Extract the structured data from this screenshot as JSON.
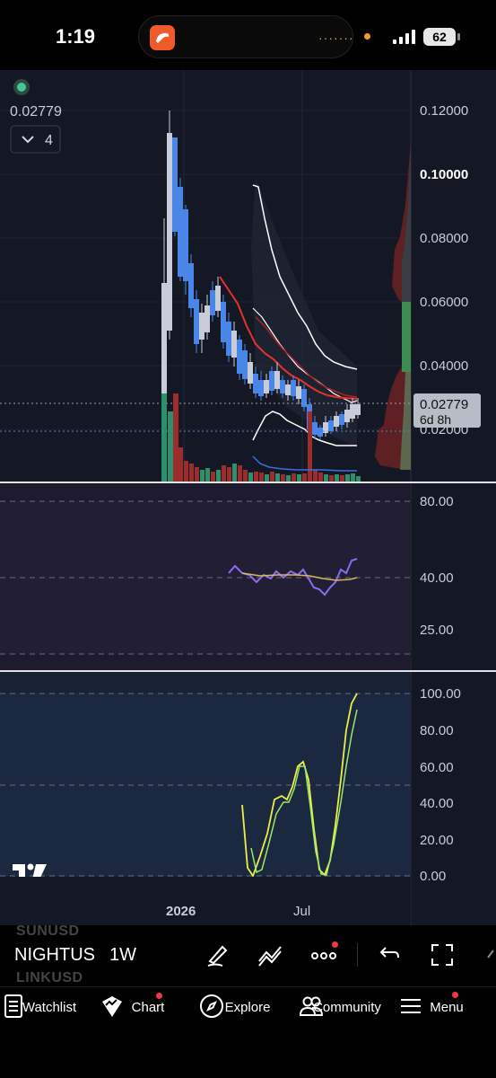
{
  "status_bar": {
    "time": "1:19",
    "battery": "62"
  },
  "chart": {
    "last_price": "0.02779",
    "indicator_count": "4",
    "price_label": "0.02779",
    "countdown_label": "6d 8h",
    "price_axis_labels": [
      "0.12000",
      "0.10000",
      "0.08000",
      "0.06000",
      "0.04000",
      "0.02000"
    ],
    "rsi_axis_labels": [
      "80.00",
      "40.00",
      "25.00"
    ],
    "stoch_axis_labels": [
      "100.00",
      "80.00",
      "60.00",
      "40.00",
      "20.00",
      "0.00"
    ],
    "time_axis_labels": [
      "2026",
      "Jul"
    ],
    "watermark": "17",
    "colors": {
      "background": "#141824",
      "up": "#c8ccd6",
      "down": "#4a86e8",
      "rsi_line": "#8c6cf0",
      "rsi_ma": "#d4b860",
      "stoch_k": "#eaf04a",
      "stoch_d": "#9be86a",
      "ma_red": "#e8302f",
      "band_white": "#ffffff",
      "volume_up": "#2f8f6a",
      "volume_down": "#c0392b"
    }
  },
  "toolbar": {
    "symbol": "NIGHTUS",
    "interval": "1W",
    "ghost_symbols": [
      "SUNUSD",
      "LINKUSD"
    ]
  },
  "tabs": [
    {
      "label": "Watchlist",
      "icon": "watchlist-icon"
    },
    {
      "label": "Chart",
      "icon": "chart-icon"
    },
    {
      "label": "Explore",
      "icon": "compass-icon"
    },
    {
      "label": "Community",
      "icon": "community-icon"
    },
    {
      "label": "Menu",
      "icon": "menu-icon"
    }
  ]
}
